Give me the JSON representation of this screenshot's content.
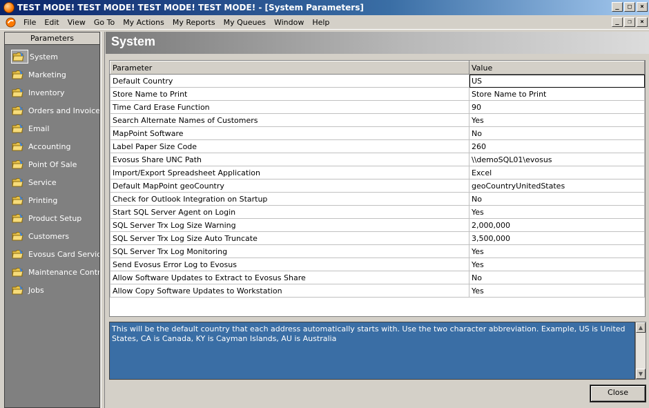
{
  "window": {
    "title": "TEST MODE!  TEST MODE!  TEST MODE!  TEST MODE! - [System Parameters]",
    "minimize": "_",
    "maximize": "□",
    "close": "×",
    "mdi_minimize": "_",
    "mdi_restore": "❐",
    "mdi_close": "×"
  },
  "menu": {
    "items": [
      "File",
      "Edit",
      "View",
      "Go To",
      "My Actions",
      "My Reports",
      "My Queues",
      "Window",
      "Help"
    ]
  },
  "sidebar": {
    "header": "Parameters",
    "items": [
      {
        "label": "System",
        "active": true
      },
      {
        "label": "Marketing"
      },
      {
        "label": "Inventory"
      },
      {
        "label": "Orders and Invoices"
      },
      {
        "label": "Email"
      },
      {
        "label": "Accounting"
      },
      {
        "label": "Point Of Sale"
      },
      {
        "label": "Service"
      },
      {
        "label": "Printing"
      },
      {
        "label": "Product Setup"
      },
      {
        "label": "Customers"
      },
      {
        "label": "Evosus Card Services"
      },
      {
        "label": "Maintenance Contr..."
      },
      {
        "label": "Jobs"
      }
    ]
  },
  "main": {
    "title": "System",
    "columns": [
      "Parameter",
      "Value"
    ],
    "rows": [
      [
        "Default Country",
        "US"
      ],
      [
        "Store Name to Print",
        "Store Name to Print"
      ],
      [
        "Time Card Erase Function",
        "90"
      ],
      [
        "Search Alternate Names of Customers",
        "Yes"
      ],
      [
        "MapPoint Software",
        "No"
      ],
      [
        "Label Paper Size Code",
        "260"
      ],
      [
        "Evosus Share UNC Path",
        "\\\\demoSQL01\\evosus"
      ],
      [
        "Import/Export Spreadsheet Application",
        "Excel"
      ],
      [
        "Default MapPoint geoCountry",
        "geoCountryUnitedStates"
      ],
      [
        "Check for Outlook Integration on Startup",
        "No"
      ],
      [
        "Start SQL Server Agent on Login",
        "Yes"
      ],
      [
        "SQL Server Trx Log Size Warning",
        "2,000,000"
      ],
      [
        "SQL Server Trx Log Size Auto Truncate",
        "3,500,000"
      ],
      [
        "SQL Server Trx Log Monitoring",
        "Yes"
      ],
      [
        "Send Evosus Error Log to Evosus",
        "Yes"
      ],
      [
        "Allow Software Updates to Extract to Evosus Share",
        "No"
      ],
      [
        "Allow Copy Software Updates to Workstation",
        "Yes"
      ]
    ],
    "description": "This will be the default country that each address automatically starts with.  Use the two  character abbreviation.  Example, US is United States, CA is Canada, KY is Cayman Islands, AU is Australia",
    "close_label": "Close"
  },
  "colors": {
    "title_bar": "#0a246a",
    "description_bg": "#3a6ea5",
    "sidebar_bg": "#808080"
  }
}
